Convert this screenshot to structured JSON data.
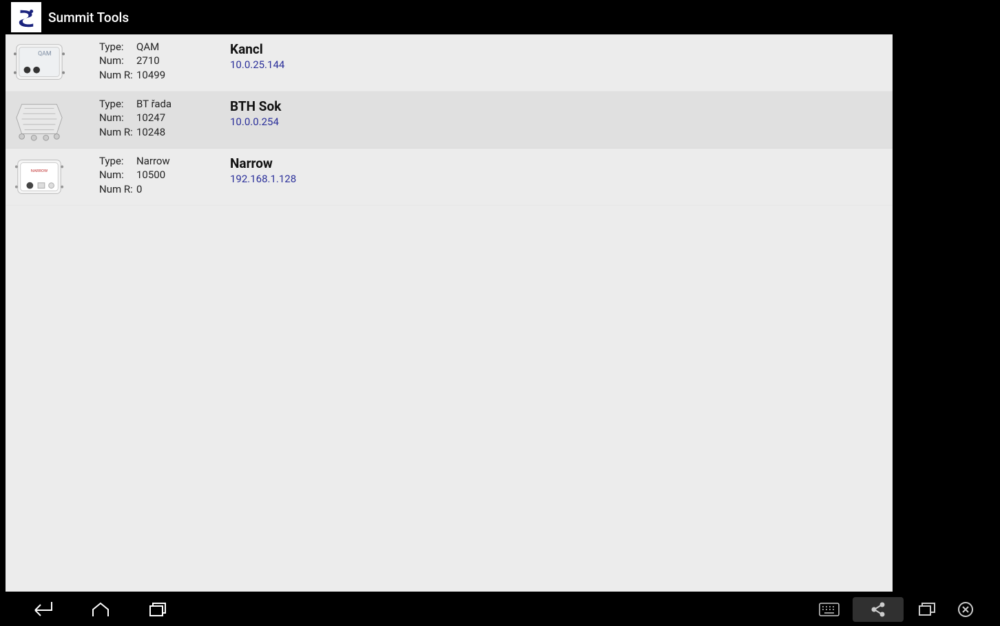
{
  "header": {
    "title": "Summit Tools"
  },
  "labels": {
    "type": "Type:",
    "num": "Num:",
    "numr": "Num R:"
  },
  "devices": [
    {
      "type": "QAM",
      "num": "2710",
      "numr": "10499",
      "name": "Kancl",
      "ip": "10.0.25.144"
    },
    {
      "type": "BT řada",
      "num": "10247",
      "numr": "10248",
      "name": "BTH Sok",
      "ip": "10.0.0.254"
    },
    {
      "type": "Narrow",
      "num": "10500",
      "numr": "0",
      "name": "Narrow",
      "ip": "192.168.1.128"
    }
  ]
}
